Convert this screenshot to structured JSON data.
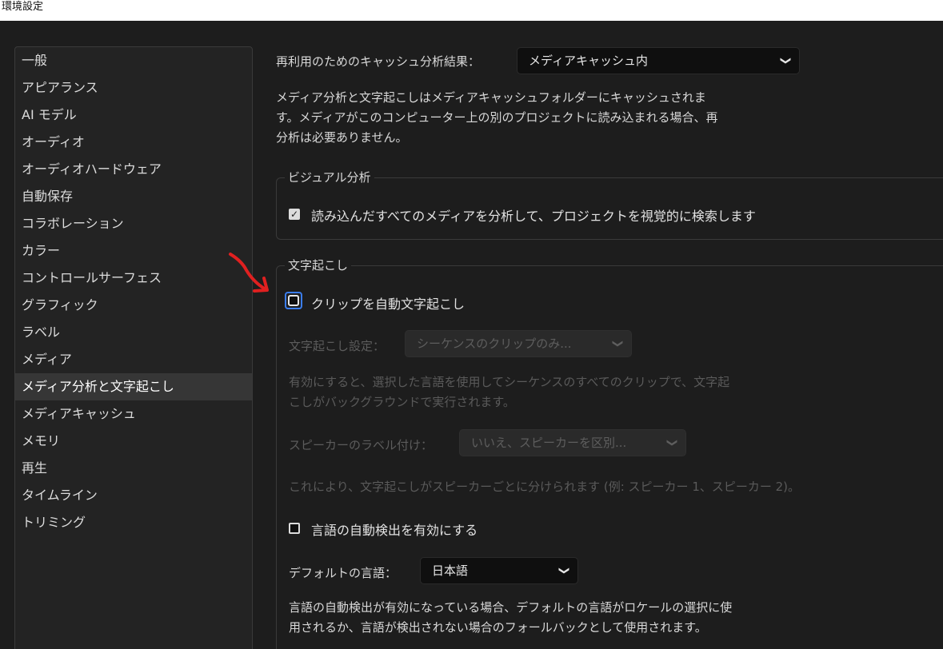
{
  "window": {
    "title": "環境設定"
  },
  "sidebar": {
    "items": [
      {
        "label": "一般"
      },
      {
        "label": "アピアランス"
      },
      {
        "label": "AI モデル"
      },
      {
        "label": "オーディオ"
      },
      {
        "label": "オーディオハードウェア"
      },
      {
        "label": "自動保存"
      },
      {
        "label": "コラボレーション"
      },
      {
        "label": "カラー"
      },
      {
        "label": "コントロールサーフェス"
      },
      {
        "label": "グラフィック"
      },
      {
        "label": "ラベル"
      },
      {
        "label": "メディア"
      },
      {
        "label": "メディア分析と文字起こし",
        "selected": true
      },
      {
        "label": "メディアキャッシュ"
      },
      {
        "label": "メモリ"
      },
      {
        "label": "再生"
      },
      {
        "label": "タイムライン"
      },
      {
        "label": "トリミング"
      }
    ]
  },
  "main": {
    "cache": {
      "label": "再利用のためのキャッシュ分析結果：",
      "value": "メディアキャッシュ内",
      "description_line1": "メディア分析と文字起こしはメディアキャッシュフォルダーにキャッシュされま",
      "description_line2": "す。メディアがこのコンピューター上の別のプロジェクトに読み込まれる場合、再",
      "description_line3": "分析は必要ありません。"
    },
    "visual_analysis": {
      "title": "ビジュアル分析",
      "checkbox_label": "読み込んだすべてのメディアを分析して、プロジェクトを視覚的に検索します",
      "checked": true
    },
    "transcription": {
      "title": "文字起こし",
      "auto_transcribe_label": "クリップを自動文字起こし",
      "auto_transcribe_checked": false,
      "settings_label": "文字起こし設定：",
      "settings_value": "シーケンスのクリップのみ...",
      "settings_desc_line1": "有効にすると、選択した言語を使用してシーケンスのすべてのクリップで、文字起",
      "settings_desc_line2": "こしがバックグラウンドで実行されます。",
      "speaker_label": "スピーカーのラベル付け：",
      "speaker_value": "いいえ、スピーカーを区別...",
      "speaker_desc": "これにより、文字起こしがスピーカーごとに分けられます (例: スピーカー 1、スピーカー 2)。",
      "auto_detect_label": "言語の自動検出を有効にする",
      "auto_detect_checked": false,
      "default_lang_label": "デフォルトの言語：",
      "default_lang_value": "日本語",
      "lang_desc_line1": "言語の自動検出が有効になっている場合、デフォルトの言語がロケールの選択に使",
      "lang_desc_line2": "用されるか、言語が検出されない場合のフォールバックとして使用されます。"
    }
  },
  "annotation": {
    "arrow_color": "#e02020"
  },
  "icons": {
    "chevron": "chevron-down-icon",
    "check": "checkmark-icon"
  }
}
